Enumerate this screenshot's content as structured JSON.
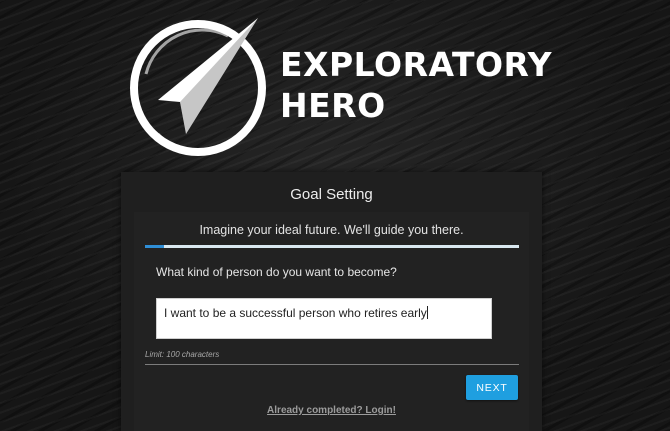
{
  "brand": {
    "line1": "EXPLORATORY",
    "line2": "HERO",
    "logo_icon": "compass-arrow-icon"
  },
  "card": {
    "title": "Goal Setting",
    "subtitle": "Imagine your ideal future. We'll guide you there.",
    "progress": 0.05,
    "question": "What kind of person do you want to become?",
    "input_value": "I want to be a successful person who retires early",
    "limit_text": "Limit: 100 characters",
    "next_label": "NEXT",
    "login_link": "Already completed? Login!"
  },
  "colors": {
    "accent": "#1f9fe0",
    "progress_fill": "#2f8ed6",
    "progress_track": "#d9e8f0",
    "card_bg": "#1f1f1f"
  }
}
